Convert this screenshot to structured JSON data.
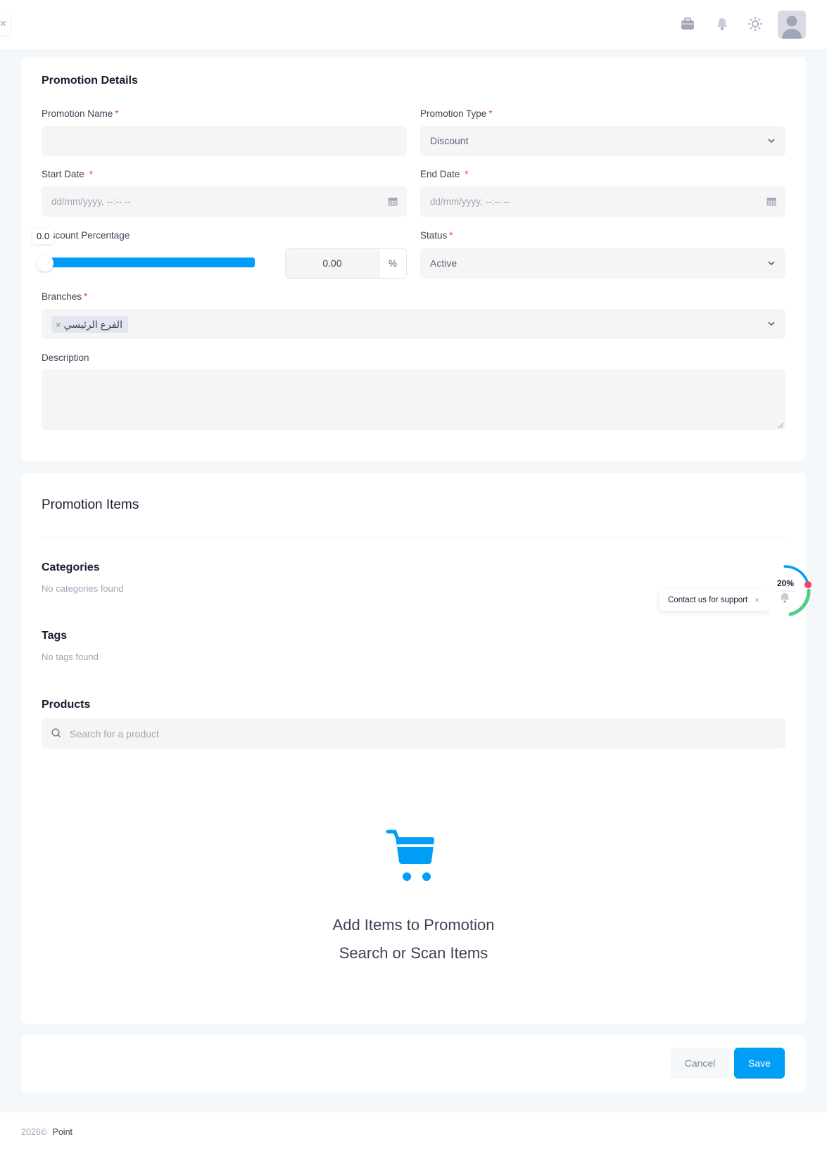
{
  "colors": {
    "accent": "#009ef7",
    "required": "#f1416c",
    "progress_green": "#50cd89",
    "progress_blue": "#009ef7",
    "progress_dot": "#f1416c"
  },
  "topbar": {
    "collapse_icon": "close-icon",
    "icons": [
      "briefcase-icon",
      "bell-icon",
      "sun-icon"
    ],
    "avatar_icon": "user-avatar-icon"
  },
  "details": {
    "title": "Promotion Details",
    "promotion_name": {
      "label": "Promotion Name",
      "required": "*",
      "value": ""
    },
    "promotion_type": {
      "label": "Promotion Type",
      "required": "*",
      "value": "Discount"
    },
    "start_date": {
      "label": "Start Date",
      "required": "*",
      "placeholder": "dd/mm/yyyy, --:-- --"
    },
    "end_date": {
      "label": "End Date",
      "required": "*",
      "placeholder": "dd/mm/yyyy, --:-- --"
    },
    "discount": {
      "label": "Discount Percentage",
      "tooltip": "0.0",
      "value": "0.00",
      "unit": "%",
      "slider_value": 0
    },
    "status": {
      "label": "Status",
      "required": "*",
      "value": "Active"
    },
    "branches": {
      "label": "Branches",
      "required": "*",
      "selected": [
        "الفرع الرئيسي"
      ],
      "remove_icon": "×"
    },
    "description": {
      "label": "Description",
      "value": ""
    }
  },
  "items": {
    "title": "Promotion Items",
    "categories": {
      "title": "Categories",
      "empty": "No categories found"
    },
    "tags": {
      "title": "Tags",
      "empty": "No tags found"
    },
    "products": {
      "title": "Products",
      "search_placeholder": "Search for a product"
    },
    "empty_state": {
      "icon": "cart-icon",
      "line1": "Add Items to Promotion",
      "line2": "Search or Scan Items"
    }
  },
  "actions": {
    "cancel": "Cancel",
    "save": "Save"
  },
  "support": {
    "label": "Contact us for support",
    "close": "×",
    "progress_text": "20%",
    "progress_value": 20
  },
  "footer": {
    "year": "2026©",
    "brand": "Point"
  }
}
